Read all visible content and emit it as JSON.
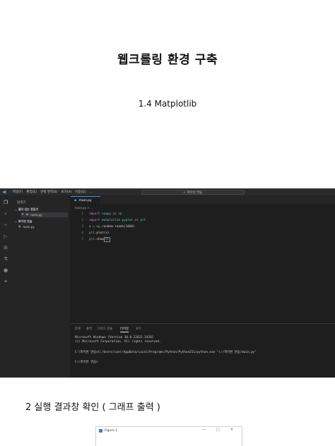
{
  "document": {
    "title": "웹크롤링 환경 구축",
    "subtitle": "1.4 Matplotlib",
    "section_heading": "2 실행 결과창 확인 ( 그래프 출력 )"
  },
  "vscode": {
    "menu": [
      "파일(F)",
      "편집(E)",
      "선택 영역(S)",
      "보기(V)",
      "이동(G)",
      "..."
    ],
    "search_text": "파이썬 연습",
    "sidebar": {
      "title": "탐색기",
      "open_editors_label": "열려 있는 편집기",
      "open_editor_file": "main.py",
      "folder_label": "파이썬 연습",
      "folder_file": "main.py"
    },
    "tab_label": "main.py",
    "breadcrumb": "main.py > ...",
    "code": [
      {
        "n": "1",
        "tokens": [
          {
            "t": "import ",
            "c": "kw"
          },
          {
            "t": "numpy ",
            "c": "mod"
          },
          {
            "t": "as ",
            "c": "kw"
          },
          {
            "t": "np",
            "c": "mod"
          }
        ]
      },
      {
        "n": "2",
        "tokens": [
          {
            "t": "import ",
            "c": "kw"
          },
          {
            "t": "matplotlib.pyplot ",
            "c": "mod"
          },
          {
            "t": "as ",
            "c": "kw"
          },
          {
            "t": "plt",
            "c": "mod"
          }
        ]
      },
      {
        "n": "3",
        "tokens": [
          {
            "t": "x ",
            "c": "var"
          },
          {
            "t": "= ",
            "c": "pun"
          },
          {
            "t": "np",
            "c": "mod"
          },
          {
            "t": ".random.",
            "c": "pun"
          },
          {
            "t": "randn",
            "c": "fn"
          },
          {
            "t": "(",
            "c": "pun"
          },
          {
            "t": "1000",
            "c": "num"
          },
          {
            "t": ")",
            "c": "pun"
          }
        ]
      },
      {
        "n": "4",
        "tokens": [
          {
            "t": "plt",
            "c": "mod"
          },
          {
            "t": ".",
            "c": "pun"
          },
          {
            "t": "plot",
            "c": "fn"
          },
          {
            "t": "(",
            "c": "pun"
          },
          {
            "t": "x",
            "c": "var"
          },
          {
            "t": ")",
            "c": "pun"
          }
        ]
      },
      {
        "n": "5",
        "tokens": [
          {
            "t": "plt",
            "c": "mod"
          },
          {
            "t": ".",
            "c": "pun"
          },
          {
            "t": "show",
            "c": "fn"
          },
          {
            "t": "()",
            "c": "pun"
          }
        ]
      }
    ],
    "panel_tabs": [
      "문제",
      "출력",
      "디버그 콘솔",
      "터미널",
      "포트"
    ],
    "panel_active_tab": "터미널",
    "terminal": [
      "Microsoft Windows [Version 10.0.22621.2428]",
      "(c) Microsoft Corporation. All rights reserved.",
      "",
      "C:\\파이썬 연습>C:/Users/user/AppData/Local/Programs/Python/Python311/python.exe \"c:/파이썬 연습/main.py\"",
      "",
      "C:\\파이썬 연습>"
    ]
  },
  "figure_window": {
    "title": "Figure 1",
    "buttons": [
      "—",
      "□",
      "✕"
    ]
  },
  "colors": {
    "accent": "#3794ff",
    "editor_bg": "#1e1e1e",
    "keyword": "#c586c0",
    "module": "#4ec9b0"
  }
}
